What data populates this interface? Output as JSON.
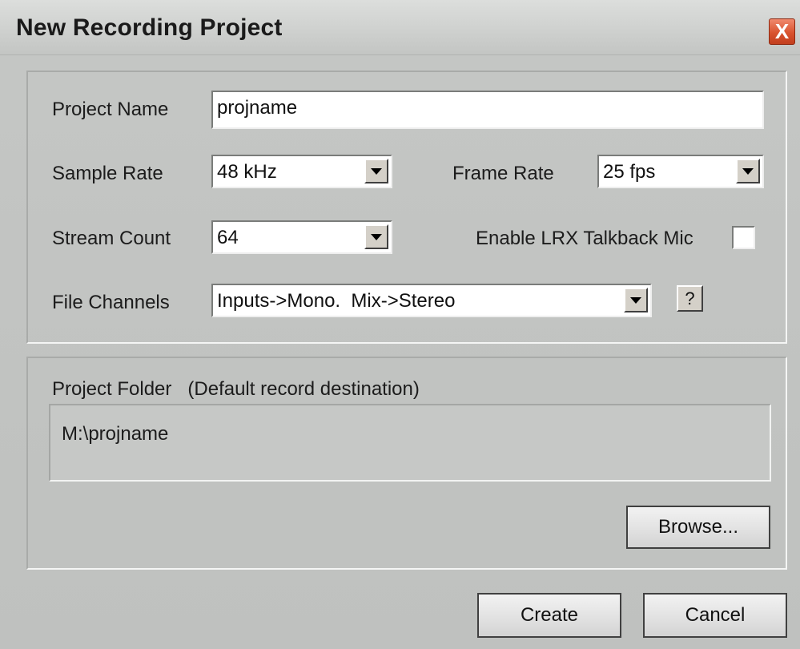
{
  "window": {
    "title": "New Recording Project",
    "close_glyph": "X",
    "close_icon": "close-icon"
  },
  "project_name": {
    "label": "Project Name",
    "value": "projname"
  },
  "sample_rate": {
    "label": "Sample Rate",
    "value": "48 kHz"
  },
  "frame_rate": {
    "label": "Frame Rate",
    "value": "25 fps"
  },
  "stream_count": {
    "label": "Stream Count",
    "value": "64"
  },
  "talkback": {
    "label": "Enable LRX Talkback Mic",
    "checked": false
  },
  "file_channels": {
    "label": "File Channels",
    "value": "Inputs->Mono.  Mix->Stereo",
    "help_label": "?"
  },
  "project_folder": {
    "label": "Project Folder   (Default record destination)",
    "path": "M:\\projname",
    "browse_label": "Browse..."
  },
  "actions": {
    "create_label": "Create",
    "cancel_label": "Cancel"
  },
  "colors": {
    "close_button": "#d9532f",
    "dialog_background": "#c4c6c4"
  }
}
